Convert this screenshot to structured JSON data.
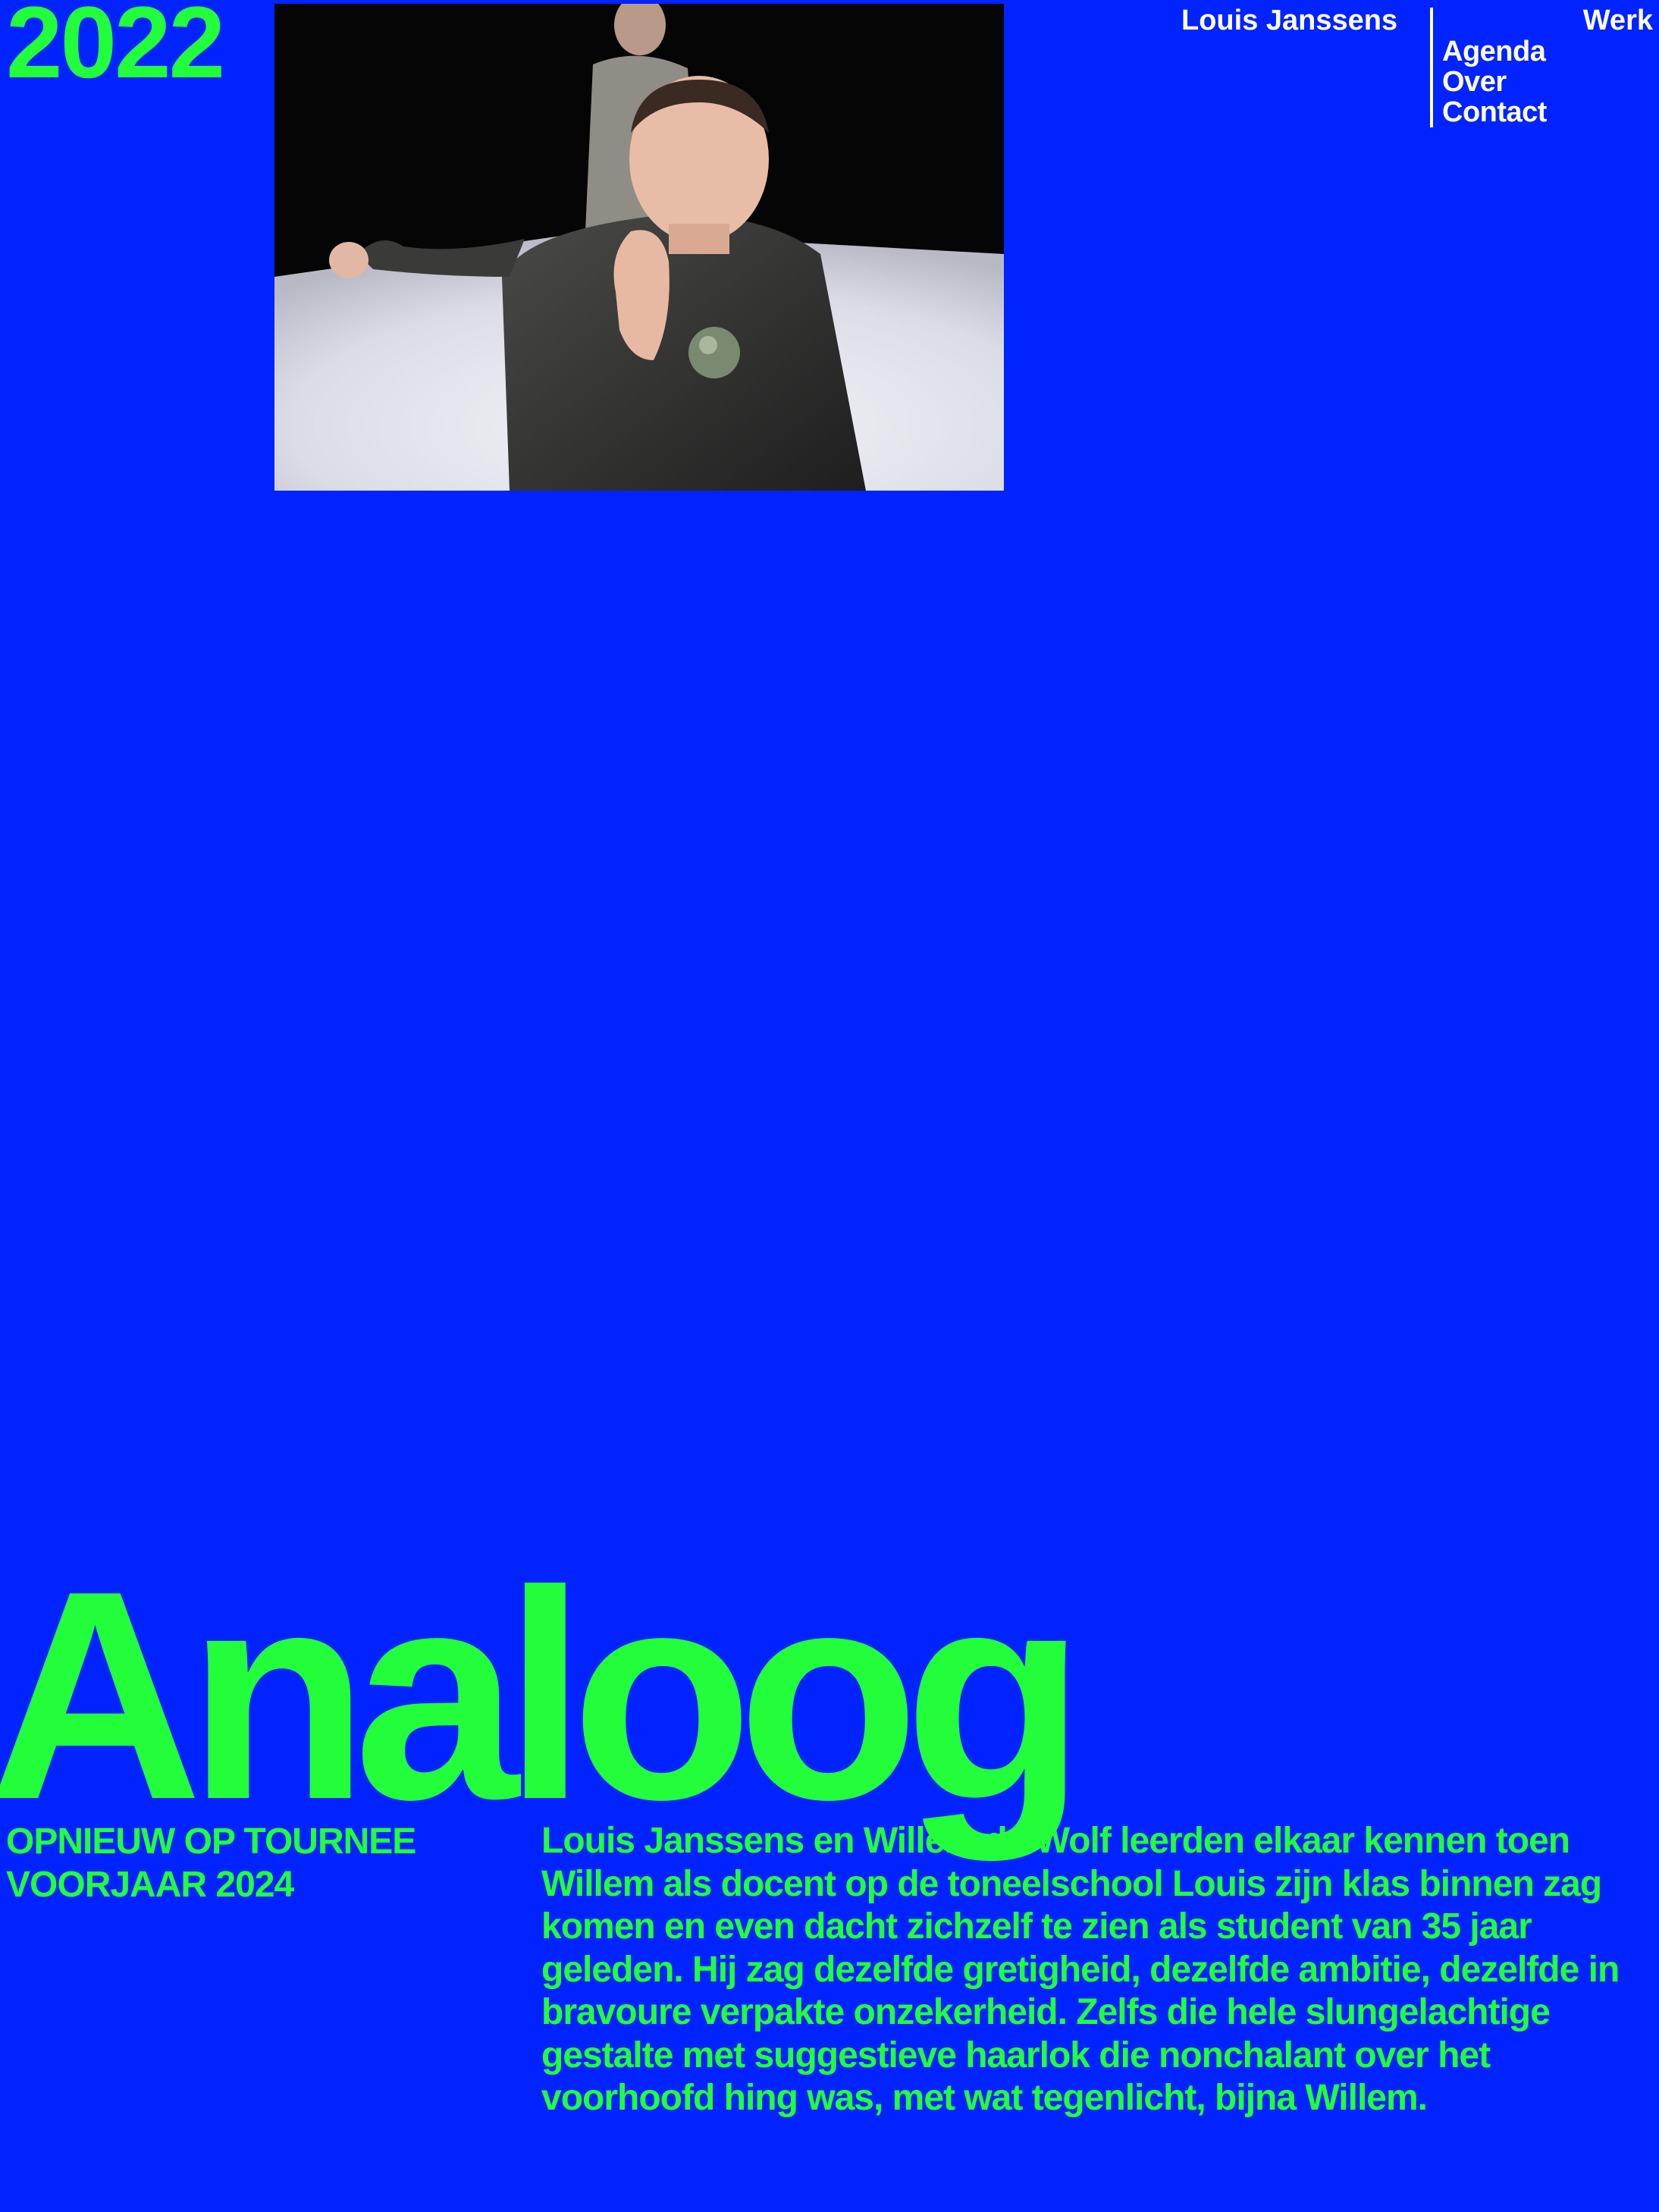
{
  "header": {
    "year": "2022",
    "site_name": "Louis Janssens",
    "nav": {
      "werk": "Werk",
      "agenda": "Agenda",
      "over": "Over",
      "contact": "Contact"
    }
  },
  "main": {
    "title": "Analoog",
    "tour_notice": "OPNIEUW OP TOURNEE VOORJAAR 2024",
    "description": "Louis Janssens en Willem de Wolf leerden elkaar kennen toen Willem als docent op de toneelschool Louis zijn klas binnen zag komen en even dacht zichzelf te zien als student van 35 jaar geleden. Hij zag dezelfde gretigheid, dezelfde ambitie, dezelfde in bravoure verpakte onzekerheid. Zelfs die hele slungelachtige gestalte met suggestieve haarlok die nonchalant over het voorhoofd hing was, met wat tegenlicht, bijna Willem."
  },
  "colors": {
    "background": "#0023ff",
    "accent": "#22ff3a",
    "nav_text": "#ffffff"
  }
}
